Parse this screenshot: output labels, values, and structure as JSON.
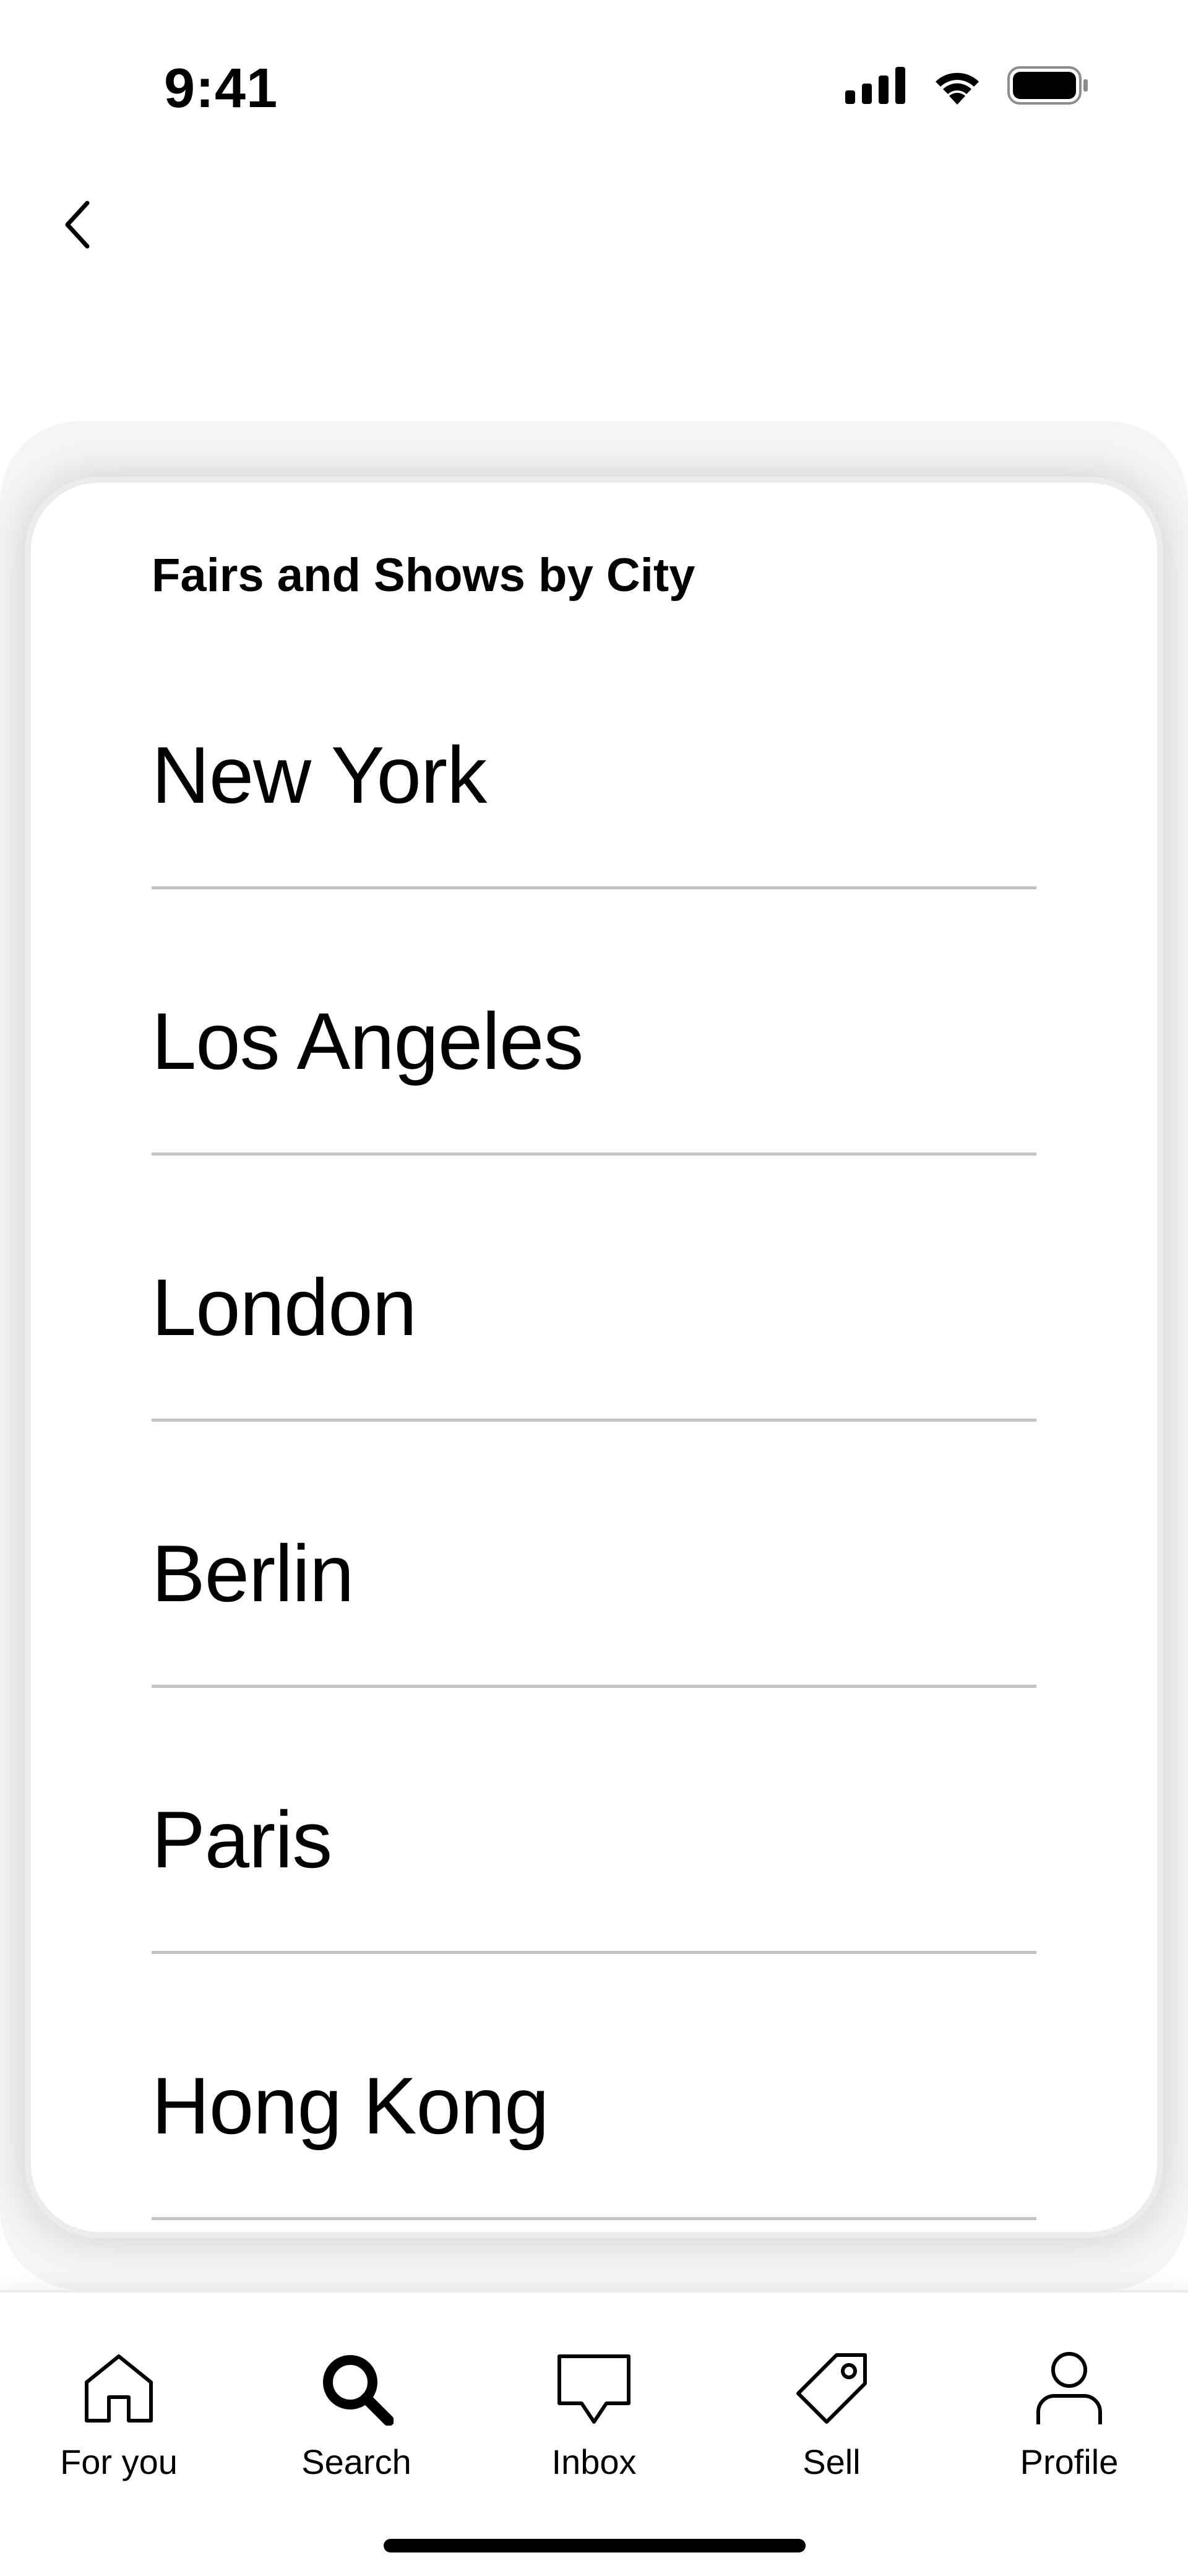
{
  "status_bar": {
    "time": "9:41",
    "icons": [
      "cellular-signal-icon",
      "wifi-icon",
      "battery-icon"
    ]
  },
  "nav": {
    "back_icon": "chevron-left-icon"
  },
  "sheet": {
    "title": "Fairs and Shows by City",
    "cities": [
      {
        "label": "New York"
      },
      {
        "label": "Los Angeles"
      },
      {
        "label": "London"
      },
      {
        "label": "Berlin"
      },
      {
        "label": "Paris"
      },
      {
        "label": "Hong Kong"
      }
    ]
  },
  "tab_bar": {
    "active_tab": "Search",
    "tabs": [
      {
        "label": "For you",
        "icon": "home-icon"
      },
      {
        "label": "Search",
        "icon": "search-icon"
      },
      {
        "label": "Inbox",
        "icon": "inbox-icon"
      },
      {
        "label": "Sell",
        "icon": "tag-icon"
      },
      {
        "label": "Profile",
        "icon": "profile-icon"
      }
    ]
  },
  "colors": {
    "text": "#000000",
    "background": "#ffffff",
    "divider": "#c4c4c4",
    "sheet_halo": "#f5f5f5"
  }
}
